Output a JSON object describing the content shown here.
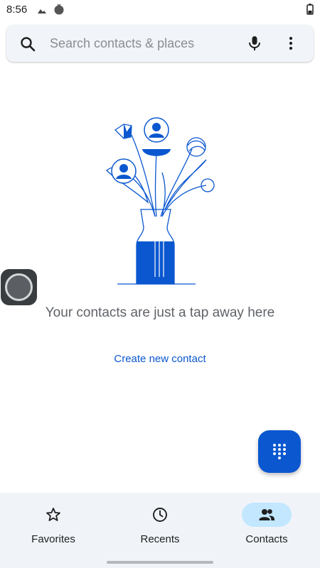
{
  "status_bar": {
    "time": "8:56",
    "icons": [
      "signal-triangle-icon",
      "notification-dot-icon",
      "battery-icon"
    ]
  },
  "search": {
    "placeholder": "Search contacts & places",
    "icons": [
      "search-icon",
      "microphone-icon",
      "more-vertical-icon"
    ]
  },
  "empty_state": {
    "illustration": "vase-with-flowers-contacts-illustration",
    "message": "Your contacts are just a tap away here",
    "action_label": "Create new contact"
  },
  "fab": {
    "icon": "dialpad-icon"
  },
  "bottom_nav": {
    "items": [
      {
        "label": "Favorites",
        "icon": "star-icon",
        "active": false
      },
      {
        "label": "Recents",
        "icon": "clock-icon",
        "active": false
      },
      {
        "label": "Contacts",
        "icon": "people-icon",
        "active": true
      }
    ]
  },
  "colors": {
    "accent": "#0b57d0",
    "active_pill": "#c2e7ff",
    "nav_background": "#f0f4f9",
    "search_background": "#f1f4f9"
  }
}
